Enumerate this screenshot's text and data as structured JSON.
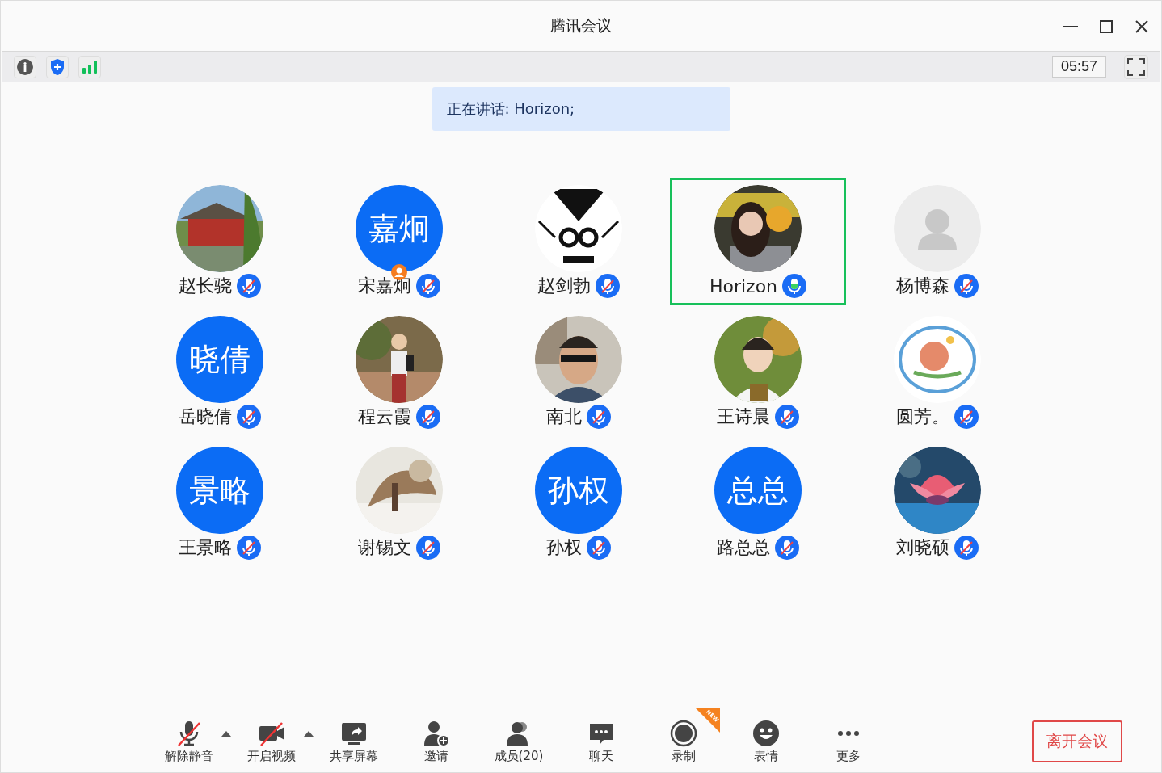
{
  "window": {
    "title": "腾讯会议"
  },
  "info_bar": {
    "timer": "05:57"
  },
  "speaking_banner": "正在讲话: Horizon;",
  "participants": [
    {
      "name": "赵长骁",
      "muted": true,
      "speaking": false,
      "host": false
    },
    {
      "name": "宋嘉炯",
      "avatar": {
        "kind": "initials",
        "text": "嘉炯"
      },
      "muted": true,
      "speaking": false,
      "host": true
    },
    {
      "name": "赵剑勃",
      "muted": true,
      "speaking": false,
      "host": false
    },
    {
      "name": "Horizon",
      "muted": false,
      "speaking": true,
      "host": false
    },
    {
      "name": "杨博森",
      "avatar": {
        "kind": "placeholder"
      },
      "muted": true,
      "speaking": false,
      "host": false
    },
    {
      "name": "岳晓倩",
      "avatar": {
        "kind": "initials",
        "text": "晓倩"
      },
      "muted": true,
      "speaking": false,
      "host": false
    },
    {
      "name": "程云霞",
      "muted": true,
      "speaking": false,
      "host": false
    },
    {
      "name": "南北",
      "muted": true,
      "speaking": false,
      "host": false
    },
    {
      "name": "王诗晨",
      "muted": true,
      "speaking": false,
      "host": false
    },
    {
      "name": "圆芳。",
      "muted": true,
      "speaking": false,
      "host": false
    },
    {
      "name": "王景略",
      "avatar": {
        "kind": "initials",
        "text": "景略"
      },
      "muted": true,
      "speaking": false,
      "host": false
    },
    {
      "name": "谢锡文",
      "muted": true,
      "speaking": false,
      "host": false
    },
    {
      "name": "孙权",
      "avatar": {
        "kind": "initials",
        "text": "孙权"
      },
      "muted": true,
      "speaking": false,
      "host": false
    },
    {
      "name": "路总总",
      "avatar": {
        "kind": "initials",
        "text": "总总"
      },
      "muted": true,
      "speaking": false,
      "host": false
    },
    {
      "name": "刘晓硕",
      "muted": true,
      "speaking": false,
      "host": false
    }
  ],
  "toolbar": [
    {
      "kind": "mic",
      "label": "解除静音",
      "off": true,
      "menu": true
    },
    {
      "kind": "video",
      "label": "开启视频",
      "off": true,
      "menu": true
    },
    {
      "kind": "share",
      "label": "共享屏幕",
      "off": false,
      "menu": false
    },
    {
      "kind": "invite",
      "label": "邀请",
      "off": false,
      "menu": false
    },
    {
      "kind": "members",
      "label": "成员(20)",
      "off": false,
      "menu": false
    },
    {
      "kind": "chat",
      "label": "聊天",
      "off": false,
      "menu": false
    },
    {
      "kind": "record",
      "label": "录制",
      "off": false,
      "menu": false,
      "badge": "NEW"
    },
    {
      "kind": "emoji",
      "label": "表情",
      "off": false,
      "menu": false
    },
    {
      "kind": "more",
      "label": "更多",
      "off": false,
      "menu": false
    }
  ],
  "leave_button": "离开会议"
}
